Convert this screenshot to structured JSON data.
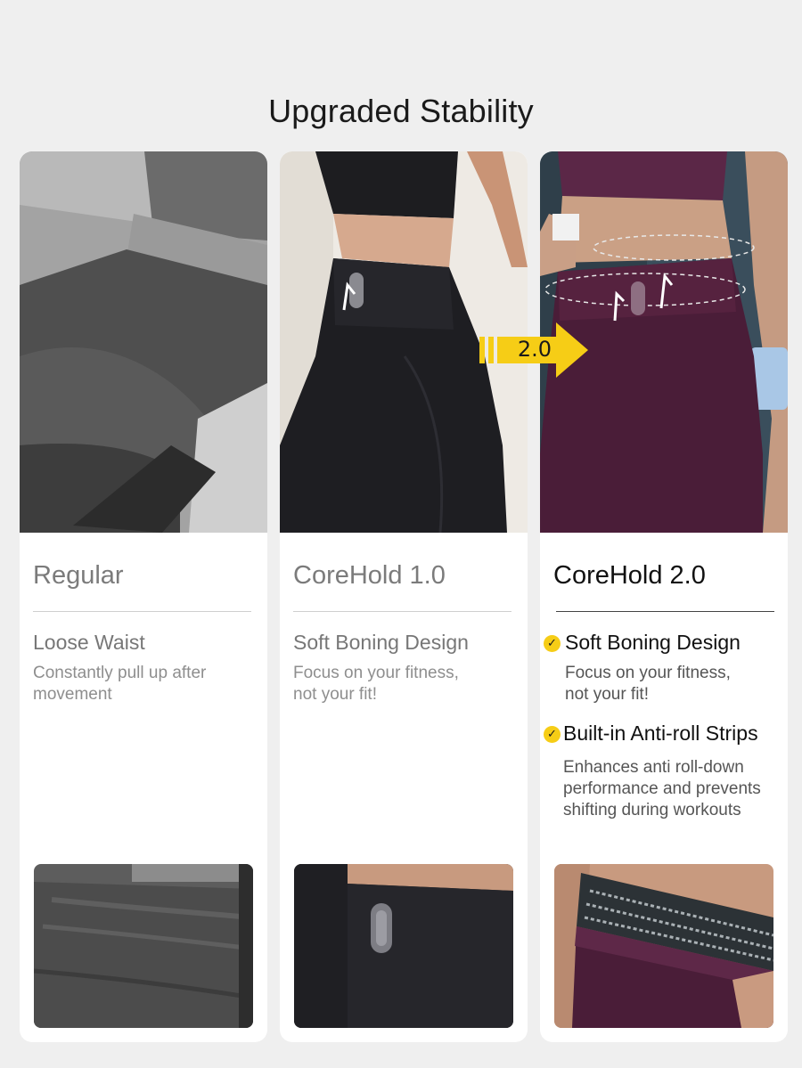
{
  "page": {
    "title": "Upgraded Stability"
  },
  "badge": {
    "label": "2.0",
    "color": "#f6cd16"
  },
  "columns": [
    {
      "title": "Regular",
      "features": [
        {
          "heading": "Loose Waist",
          "description_lines": [
            "Constantly pull up after",
            "movement"
          ]
        }
      ]
    },
    {
      "title": "CoreHold 1.0",
      "features": [
        {
          "heading": "Soft Boning Design",
          "description_lines": [
            "Focus on your fitness,",
            "not your fit!"
          ]
        }
      ]
    },
    {
      "title": "CoreHold 2.0",
      "features": [
        {
          "heading": "Soft Boning Design",
          "description_lines": [
            "Focus on your fitness,",
            "not your fit!"
          ]
        },
        {
          "heading": "Built-in Anti-roll Strips",
          "description_lines": [
            "Enhances anti roll-down",
            "performance and prevents",
            "shifting during workouts"
          ]
        }
      ]
    }
  ],
  "colors": {
    "background": "#efefef",
    "card": "#ffffff",
    "check_accent": "#f6cd16",
    "regular_fabric": "#4a4a4a",
    "corehold1_fabric": "#1e1e22",
    "corehold2_fabric": "#4a1d38"
  }
}
